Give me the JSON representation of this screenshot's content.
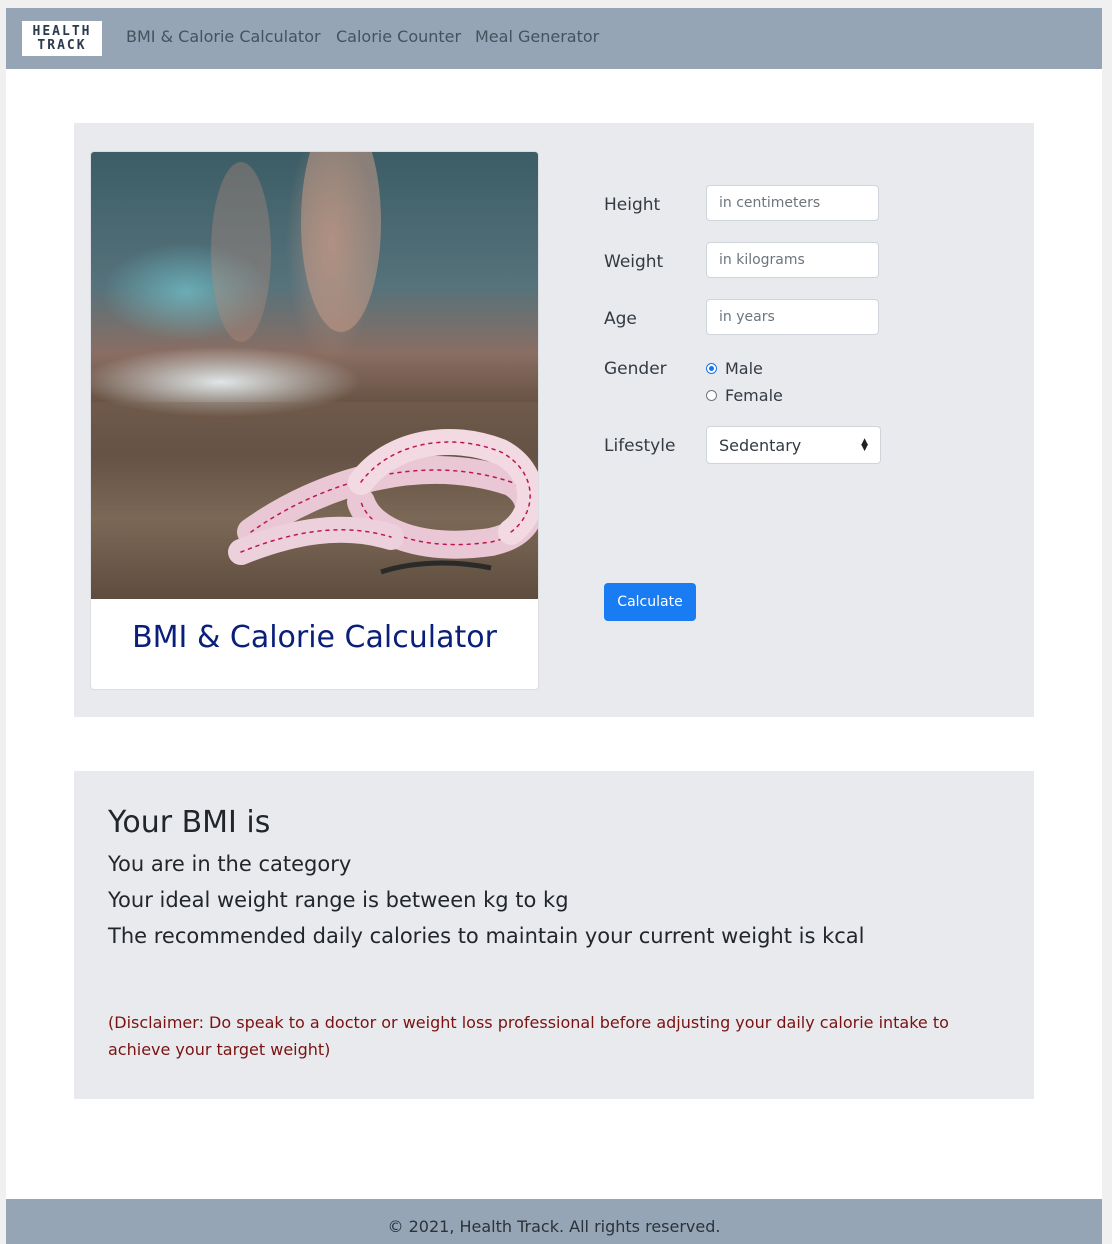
{
  "navbar": {
    "brand_line1": "HEALTH",
    "brand_line2": "TRACK",
    "links": [
      "BMI & Calorie Calculator",
      "Calorie Counter",
      "Meal Generator"
    ]
  },
  "card": {
    "title": "BMI & Calorie Calculator"
  },
  "form": {
    "height_label": "Height",
    "height_placeholder": "in centimeters",
    "weight_label": "Weight",
    "weight_placeholder": "in kilograms",
    "age_label": "Age",
    "age_placeholder": "in years",
    "gender_label": "Gender",
    "gender_options": [
      "Male",
      "Female"
    ],
    "gender_selected": "Male",
    "lifestyle_label": "Lifestyle",
    "lifestyle_selected": "Sedentary",
    "calculate_label": "Calculate"
  },
  "results": {
    "bmi_line": "Your BMI is",
    "category_line": "You are in the category",
    "ideal_weight_line": "Your ideal weight range is between kg to kg",
    "calories_line": "The recommended daily calories to maintain your current weight is kcal",
    "disclaimer": "(Disclaimer: Do speak to a doctor or weight loss professional before adjusting your daily calorie intake to achieve your target weight)"
  },
  "footer": {
    "text": "© 2021, Health Track. All rights reserved."
  },
  "colors": {
    "navbar": "#95a5b5",
    "section_bg": "#e9eaee",
    "primary": "#1a7cf2",
    "card_title": "#0a1f7a",
    "disclaimer": "#7a1212"
  }
}
